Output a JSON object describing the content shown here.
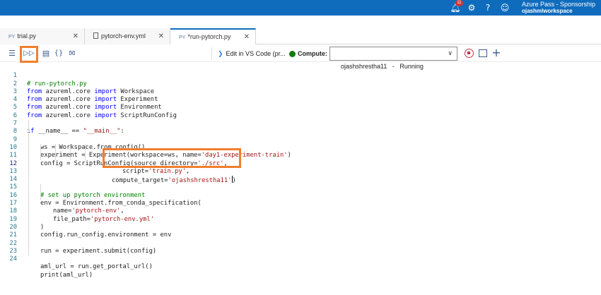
{
  "topbar": {
    "notification_count": "11",
    "account_title": "Azure Pass - Sponsorship",
    "workspace": "ojashmlworkspace",
    "icons": [
      "bell-icon",
      "gear-icon",
      "help-icon",
      "smiley-icon"
    ]
  },
  "tabs": [
    {
      "icon_text": "PY",
      "label": "trial.py",
      "active": false
    },
    {
      "icon_text": "",
      "label": "pytorch-env.yml",
      "active": false
    },
    {
      "icon_text": "PY",
      "label": "*run-pytorch.py",
      "active": true
    }
  ],
  "toolbar": {
    "edit_vscode_label": "Edit in VS Code (pr...",
    "compute_label": "Compute:",
    "compute_value": "ojashshrestha11   -   Running",
    "compute_status_color": "#107c10",
    "highlight_color": "#f07f2e"
  },
  "code": {
    "line_numbers": [
      "1",
      "2",
      "3",
      "4",
      "5",
      "6",
      "7",
      "8",
      "9",
      "10",
      "11",
      "12",
      "13",
      "14",
      "15",
      "16",
      "17",
      "18",
      "19",
      "20",
      "21",
      "22",
      "23",
      "24"
    ],
    "l1": "# run-pytorch.py",
    "l2a": "from",
    "l2b": " azureml.core ",
    "l2c": "import",
    "l2d": " Workspace",
    "l3a": "from",
    "l3b": " azureml.core ",
    "l3c": "import",
    "l3d": " Experiment",
    "l4a": "from",
    "l4b": " azureml.core ",
    "l4c": "import",
    "l4d": " Environment",
    "l5a": "from",
    "l5b": " azureml.core ",
    "l5c": "import",
    "l5d": " ScriptRunConfig",
    "l7a": "if",
    "l7b": " __name__ == ",
    "l7c": "\"__main__\"",
    "l7d": ":",
    "l8": "ws = Workspace.from_config()",
    "l9a": "experiment = Experiment(workspace=ws, name=",
    "l9b": "'day1-experiment-train'",
    "l9c": ")",
    "l10a": "config = ScriptRunConfig(source_directory=",
    "l10b": "'./src'",
    "l10c": ",",
    "l11a": "script=",
    "l11b": "'train.py'",
    "l11c": ",",
    "l12a": "compute_target=",
    "l12b": "'ojashshrestha11'",
    "l12c": ")",
    "l14": "# set up pytorch environment",
    "l15": "env = Environment.from_conda_specification(",
    "l16a": "name=",
    "l16b": "'pytorch-env'",
    "l16c": ",",
    "l17a": "file_path=",
    "l17b": "'pytorch-env.yml'",
    "l18": ")",
    "l19": "config.run_config.environment = env",
    "l21": "run = experiment.submit(config)",
    "l23": "aml_url = run.get_portal_url()",
    "l24": "print(aml_url)"
  }
}
